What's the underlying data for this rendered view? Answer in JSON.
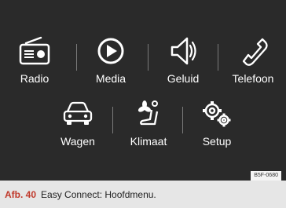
{
  "menu": {
    "items": [
      {
        "label": "Radio",
        "icon": "radio-icon"
      },
      {
        "label": "Media",
        "icon": "play-icon"
      },
      {
        "label": "Geluid",
        "icon": "speaker-icon"
      },
      {
        "label": "Telefoon",
        "icon": "phone-icon"
      },
      {
        "label": "Wagen",
        "icon": "car-icon"
      },
      {
        "label": "Klimaat",
        "icon": "climate-seat-fan-icon"
      },
      {
        "label": "Setup",
        "icon": "gears-icon"
      }
    ]
  },
  "code_label": "B5F-0680",
  "caption": {
    "figure": "Afb. 40",
    "text": "Easy Connect: Hoofdmenu."
  },
  "colors": {
    "screen_background": "#2a2a2a",
    "icon": "#ffffff",
    "separator": "#7a7a7a",
    "caption_background": "#e6e6e6",
    "figure_label": "#c0392b"
  }
}
